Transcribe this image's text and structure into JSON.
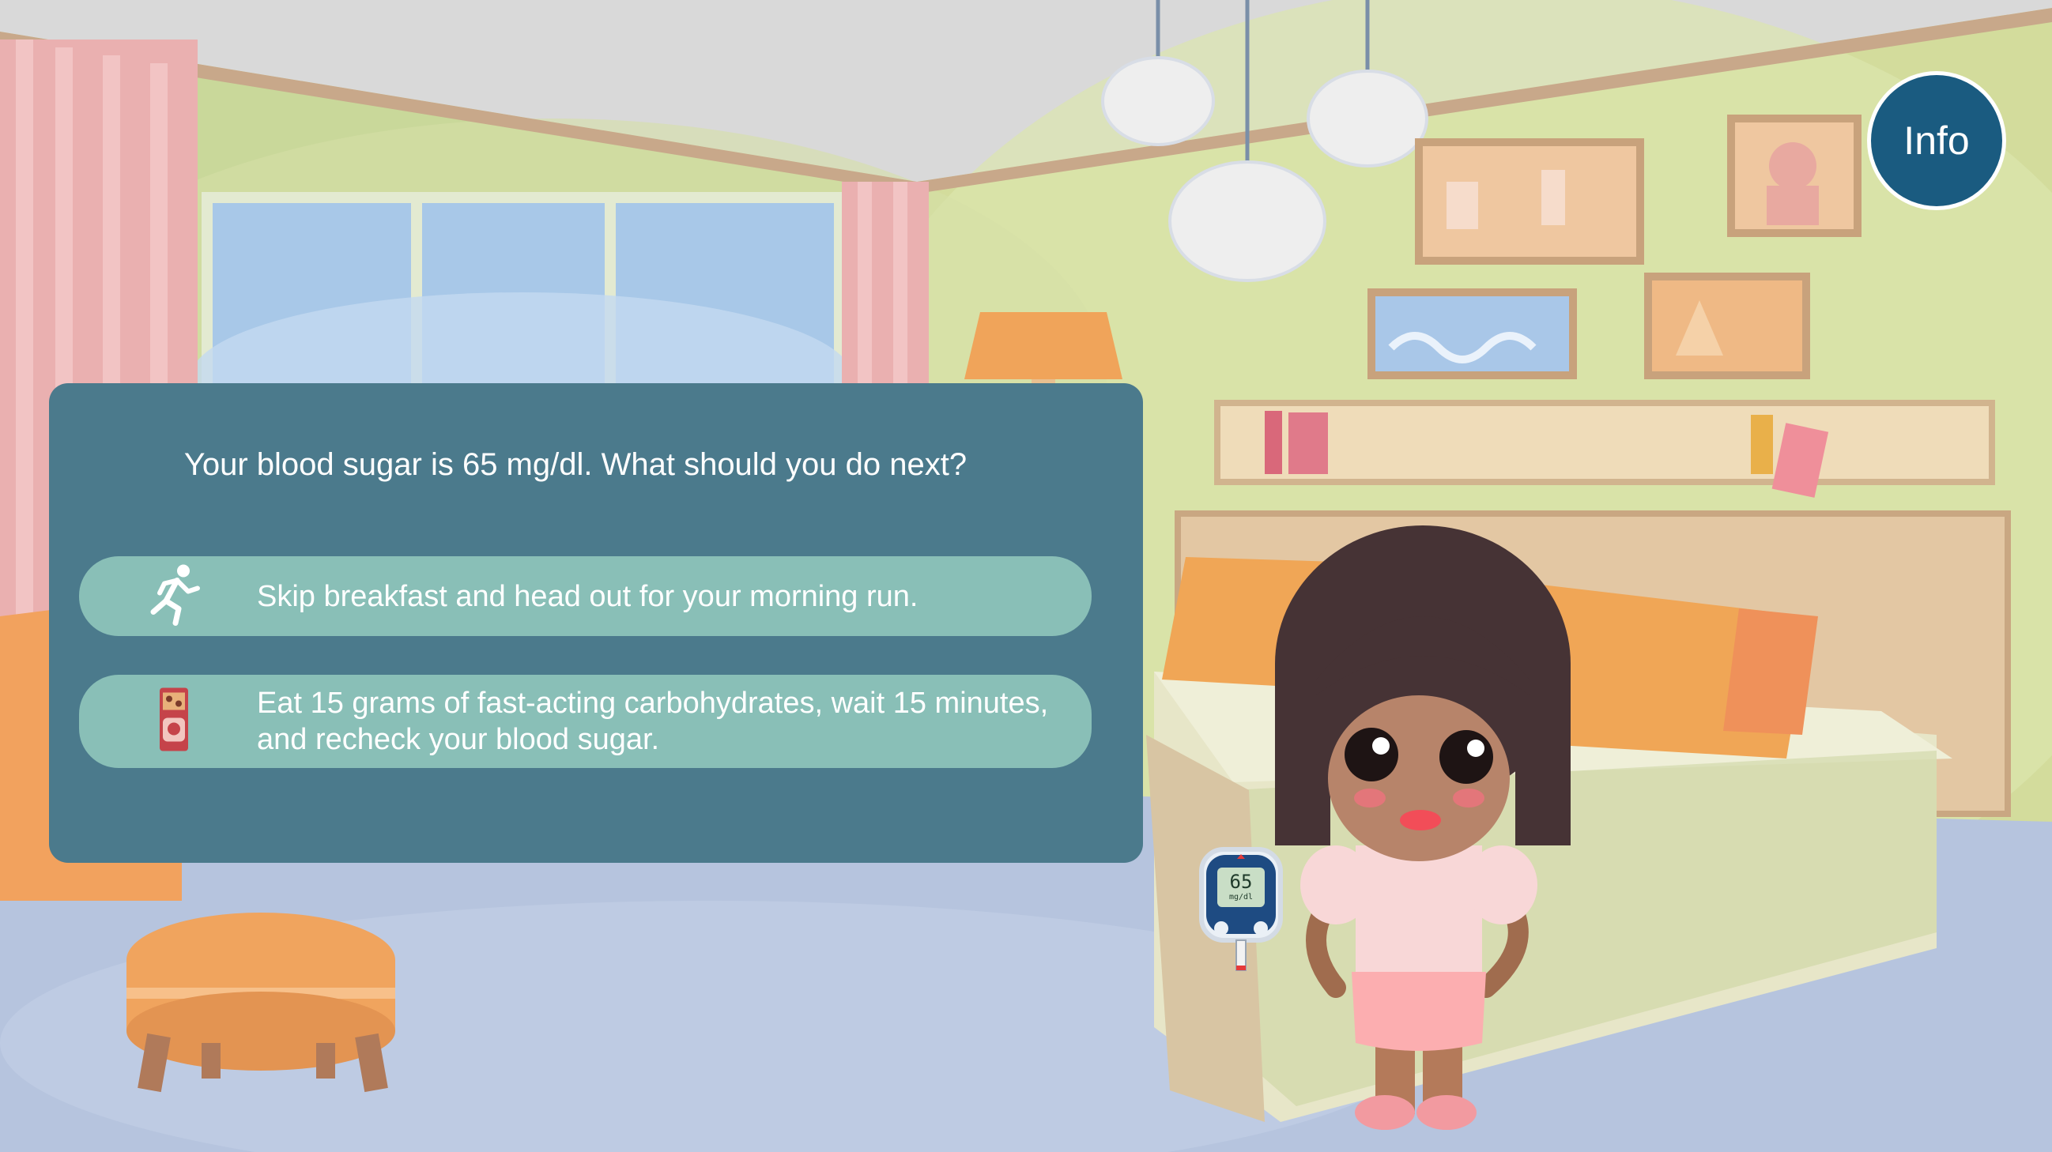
{
  "scene": {
    "name": "bedroom"
  },
  "dialog": {
    "question": "Your blood sugar is 65 mg/dl. What should you do next?",
    "choices": [
      {
        "icon": "running-person-icon",
        "label": "Skip breakfast and head out for your morning run."
      },
      {
        "icon": "candy-bar-icon",
        "label": "Eat 15 grams of fast-acting carbohydrates, wait 15 minutes, and recheck your blood sugar."
      }
    ]
  },
  "info_button": {
    "label": "Info"
  },
  "glucose_meter": {
    "reading": "65",
    "unit": "mg/dl"
  },
  "colors": {
    "dialog_bg": "#4b7a8c",
    "choice_bg": "#89bfb7",
    "info_button_bg": "#1a5b80",
    "text": "#ffffff"
  }
}
